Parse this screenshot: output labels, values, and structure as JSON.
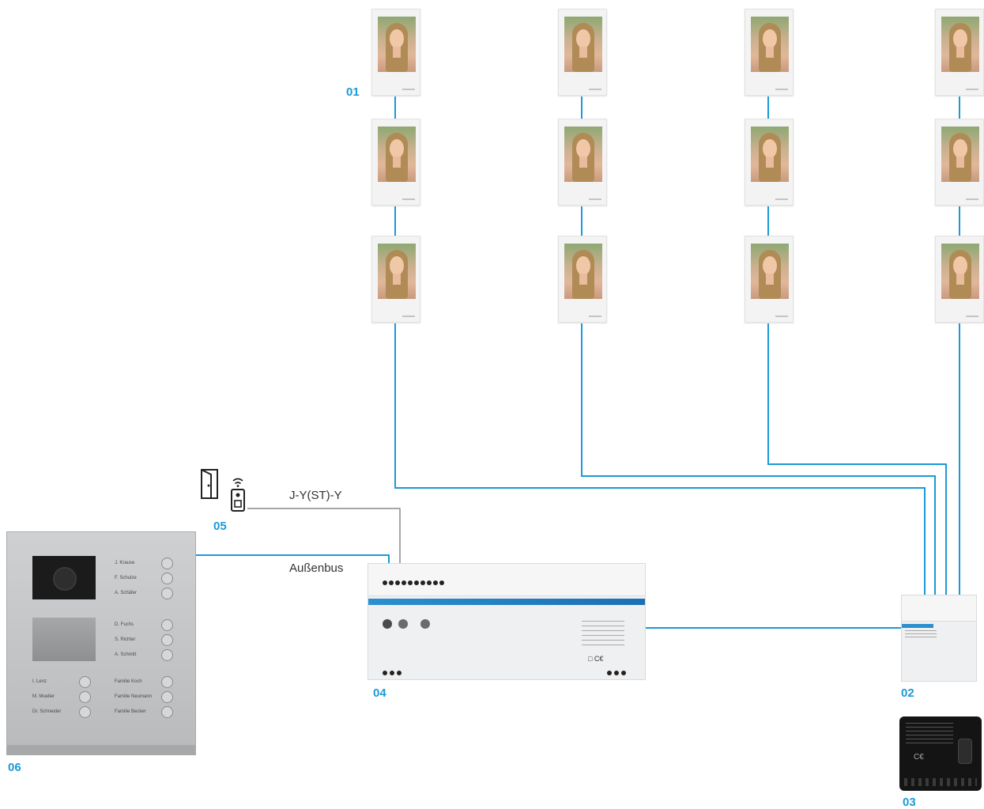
{
  "labels": {
    "l01": "01",
    "l02": "02",
    "l03": "03",
    "l04": "04",
    "l05": "05",
    "l06": "06"
  },
  "wires": {
    "cable": "J-Y(ST)-Y",
    "outer_bus": "Außenbus"
  },
  "station": {
    "left_names": [
      "I. Lenz",
      "M. Mueller",
      "Dr. Schneider"
    ],
    "right_top_names": [
      "J. Krause",
      "F. Schulze",
      "A. Schäfer"
    ],
    "right_mid_names": [
      "D. Fuchs",
      "S. Richter",
      "A. Schmitt"
    ],
    "right_bot_names": [
      "Familie Koch",
      "Familie Neumann",
      "Familie Becker"
    ]
  },
  "colors": {
    "accent": "#1a9ad6",
    "bus_line": "#1a9ad6",
    "cable_line": "#8a8a8a"
  }
}
